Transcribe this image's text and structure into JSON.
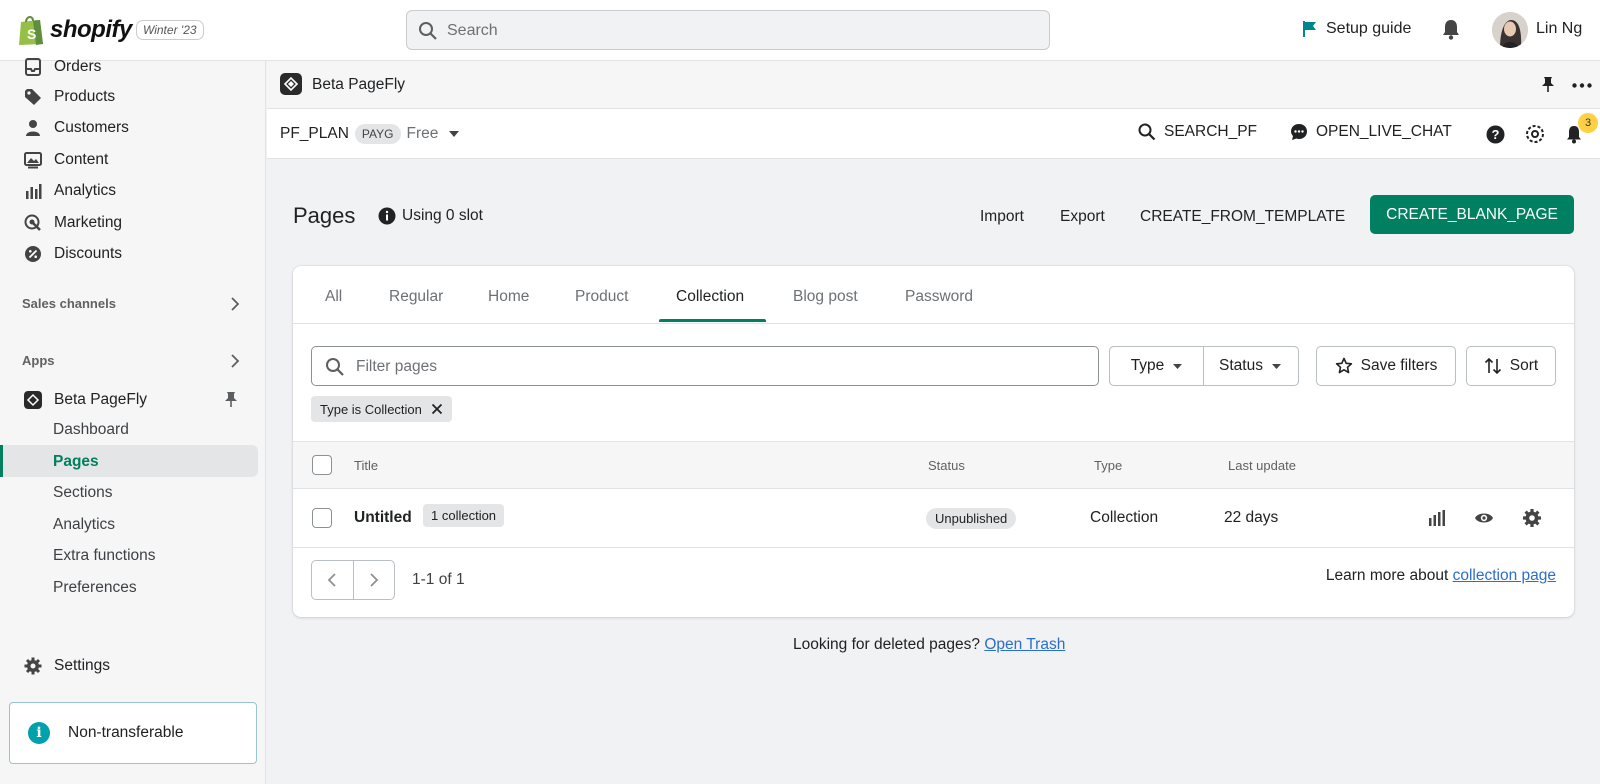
{
  "topbar": {
    "brand": "shopify",
    "edition": "Winter '23",
    "search_placeholder": "Search",
    "setup_guide": "Setup guide",
    "user_name": "Lin Ng"
  },
  "sidebar": {
    "nav": [
      {
        "label": "Orders",
        "icon": "orders-icon"
      },
      {
        "label": "Products",
        "icon": "tag-icon"
      },
      {
        "label": "Customers",
        "icon": "person-icon"
      },
      {
        "label": "Content",
        "icon": "image-icon"
      },
      {
        "label": "Analytics",
        "icon": "bar-chart-icon"
      },
      {
        "label": "Marketing",
        "icon": "target-icon"
      },
      {
        "label": "Discounts",
        "icon": "discount-icon"
      }
    ],
    "sales_channels": "Sales channels",
    "apps": "Apps",
    "app_name": "Beta PageFly",
    "app_sub": [
      "Dashboard",
      "Pages",
      "Sections",
      "Analytics",
      "Extra functions",
      "Preferences"
    ],
    "settings": "Settings",
    "notice": "Non-transferable"
  },
  "appheader": {
    "title": "Beta PageFly"
  },
  "planbar": {
    "plan": "PF_PLAN",
    "badge": "PAYG",
    "tier": "Free",
    "search": "SEARCH_PF",
    "chat": "OPEN_LIVE_CHAT",
    "notifications": "3"
  },
  "page": {
    "title": "Pages",
    "slot": "Using 0 slot",
    "import": "Import",
    "export": "Export",
    "create_template": "CREATE_FROM_TEMPLATE",
    "create_blank": "CREATE_BLANK_PAGE"
  },
  "tabs": [
    "All",
    "Regular",
    "Home",
    "Product",
    "Collection",
    "Blog post",
    "Password"
  ],
  "active_tab": "Collection",
  "filters": {
    "placeholder": "Filter pages",
    "type": "Type",
    "status": "Status",
    "save": "Save filters",
    "sort": "Sort",
    "applied_tag": "Type is Collection"
  },
  "table": {
    "headers": {
      "title": "Title",
      "status": "Status",
      "type": "Type",
      "last_update": "Last update"
    },
    "rows": [
      {
        "title": "Untitled",
        "badge": "1 collection",
        "status": "Unpublished",
        "type": "Collection",
        "last_update": "22 days"
      }
    ]
  },
  "pagination": {
    "count": "1-1 of 1",
    "learn_prefix": "Learn more about",
    "learn_link": "collection page"
  },
  "footer": {
    "text": "Looking for deleted pages?",
    "link": "Open Trash"
  },
  "colors": {
    "primary": "#008060",
    "link": "#2c6ecb",
    "notice_border": "#98c6cd",
    "notif_badge": "#ffd043"
  }
}
